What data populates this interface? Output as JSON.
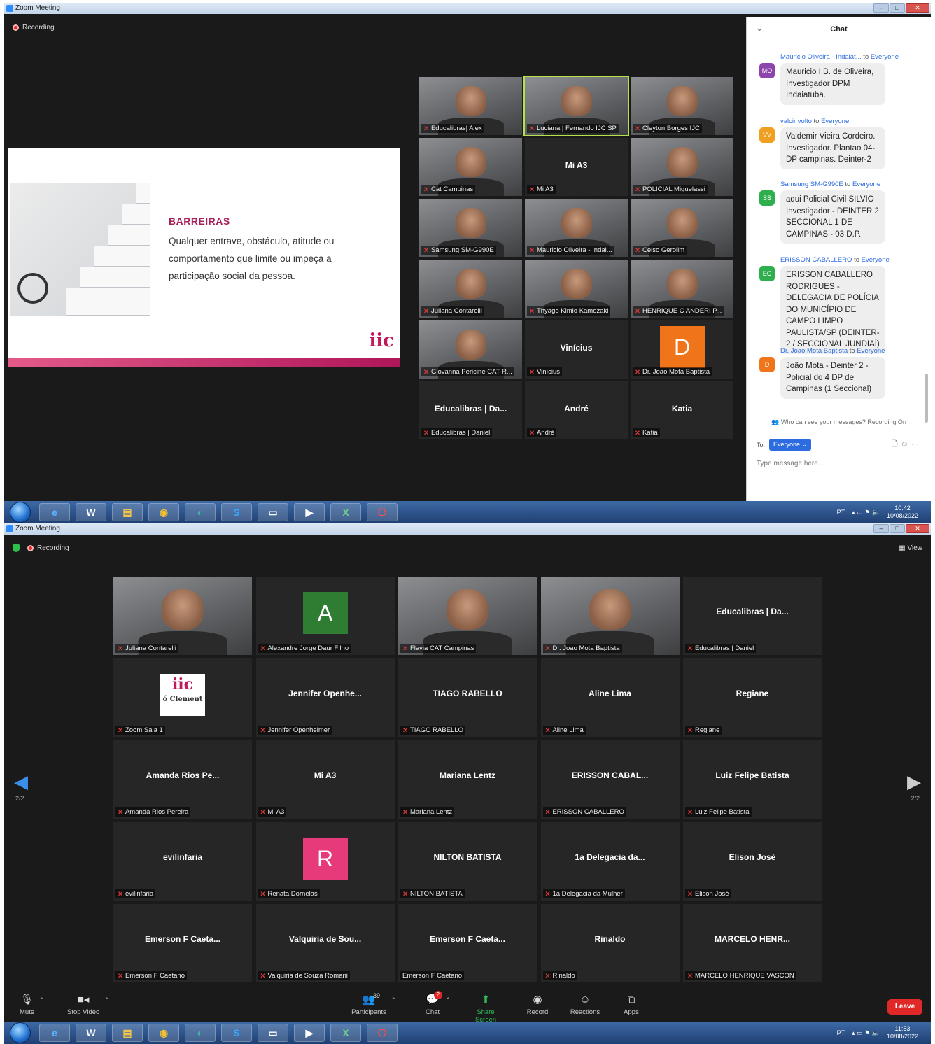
{
  "window_title": "Zoom Meeting",
  "recording_label": "Recording",
  "slide": {
    "title": "BARREIRAS",
    "text": "Qualquer entrave, obstáculo, atitude ou comportamento que limite ou impeça a participação social da pessoa.",
    "logo": "iic"
  },
  "top_tiles": [
    {
      "big": "",
      "name": "Educalibras| Alex",
      "video": true
    },
    {
      "big": "",
      "name": "Luciana | Fernando IJC SP",
      "video": true,
      "active": true
    },
    {
      "big": "",
      "name": "Cleyton Borges IJC",
      "video": true
    },
    {
      "big": "",
      "name": "Cat Campinas",
      "video": true
    },
    {
      "big": "Mi A3",
      "name": "Mi A3",
      "video": false
    },
    {
      "big": "",
      "name": "POLICIAL Miguelassi",
      "video": true
    },
    {
      "big": "",
      "name": "Samsung SM-G990E",
      "video": true
    },
    {
      "big": "",
      "name": "Mauricio Oliveira - Indai...",
      "video": true
    },
    {
      "big": "",
      "name": "Celso Gerolim",
      "video": true
    },
    {
      "big": "",
      "name": "Juliana Contarelli",
      "video": true
    },
    {
      "big": "",
      "name": "Thyago Kimio Kamozaki",
      "video": true
    },
    {
      "big": "",
      "name": "HENRIQUE C ANDERI P...",
      "video": true
    },
    {
      "big": "",
      "name": "Giovanna Pericine CAT R...",
      "video": true
    },
    {
      "big": "Vinícius",
      "name": "Vinícius",
      "video": false
    },
    {
      "big": "",
      "name": "Dr. Joao Mota Baptista",
      "video": false,
      "avatar": "D",
      "avatar_color": "#f0741a"
    },
    {
      "big": "Educalibras | Da...",
      "name": "Educalibras | Daniel",
      "video": false
    },
    {
      "big": "André",
      "name": "André",
      "video": false
    },
    {
      "big": "Katia",
      "name": "Katia",
      "video": false
    }
  ],
  "chat": {
    "title": "Chat",
    "to_word": "to",
    "messages": [
      {
        "from": "Mauricio Oliveira - Indaiat...",
        "to": "Everyone",
        "initials": "MO",
        "color": "#8e44ad",
        "text": "Mauricio I.B. de Oliveira, Investigador DPM Indaiatuba."
      },
      {
        "from": "valcir volto",
        "to": "Everyone",
        "initials": "VV",
        "color": "#f0a020",
        "text": "Valdemir Vieira Cordeiro. Investigador. Plantao 04-DP campinas. Deinter-2"
      },
      {
        "from": "Samsung SM-G990E",
        "to": "Everyone",
        "initials": "SS",
        "color": "#2fae4e",
        "text": "aqui Policial Civil SILVIO Investigador - DEINTER 2 SECCIONAL 1 DE CAMPINAS - 03 D.P."
      },
      {
        "from": "ERISSON CABALLERO",
        "to": "Everyone",
        "initials": "EC",
        "color": "#2fae4e",
        "text": "ERISSON CABALLERO RODRIGUES - DELEGACIA DE POLÍCIA DO MUNICÍPIO DE CAMPO LIMPO PAULISTA/SP (DEINTER-2 / SECCIONAL JUNDIAÍ)"
      },
      {
        "from": "Dr. Joao Mota Baptista",
        "to": "Everyone",
        "initials": "D",
        "color": "#f0741a",
        "text": "João Mota - Deinter 2 - Policial do 4 DP de Campinas (1 Seccional)"
      }
    ],
    "notice": "Who can see your messages? Recording On",
    "to_label": "To:",
    "recipient": "Everyone",
    "placeholder": "Type message here..."
  },
  "taskbar": {
    "lang": "PT",
    "clock1_time": "10:42",
    "clock1_date": "10/08/2022",
    "clock2_time": "11:53",
    "clock2_date": "10/08/2022"
  },
  "gallery": {
    "view_label": "View",
    "page": "2/2",
    "tiles": [
      {
        "big": "",
        "name": "Juliana Contarelli",
        "video": true
      },
      {
        "big": "",
        "name": "Alexandre Jorge Daur Filho",
        "video": false,
        "avatar": "A",
        "avatar_color": "#2e7d32"
      },
      {
        "big": "",
        "name": "Flavia CAT Campinas",
        "video": true
      },
      {
        "big": "",
        "name": "Dr. Joao Mota Baptista",
        "video": true
      },
      {
        "big": "Educalibras | Da...",
        "name": "Educalibras | Daniel",
        "video": false
      },
      {
        "big": "",
        "name": "Zoom Sala 1",
        "video": false,
        "logo": "iic",
        "logo_sub": "ó Clement"
      },
      {
        "big": "Jennifer Openhe...",
        "name": "Jennifer Openheimer",
        "video": false
      },
      {
        "big": "TIAGO RABELLO",
        "name": "TIAGO RABELLO",
        "video": false
      },
      {
        "big": "Aline Lima",
        "name": "Aline Lima",
        "video": false
      },
      {
        "big": "Regiane",
        "name": "Regiane",
        "video": false
      },
      {
        "big": "Amanda Rios Pe...",
        "name": "Amanda Rios Pereira",
        "video": false
      },
      {
        "big": "Mi A3",
        "name": "Mi A3",
        "video": false
      },
      {
        "big": "Mariana Lentz",
        "name": "Mariana Lentz",
        "video": false
      },
      {
        "big": "ERISSON CABAL...",
        "name": "ERISSON CABALLERO",
        "video": false
      },
      {
        "big": "Luiz Felipe Batista",
        "name": "Luiz Felipe Batista",
        "video": false
      },
      {
        "big": "evilinfaria",
        "name": "evilinfaria",
        "video": false
      },
      {
        "big": "",
        "name": "Renata Dornelas",
        "video": false,
        "avatar": "R",
        "avatar_color": "#e63a7a"
      },
      {
        "big": "NILTON BATISTA",
        "name": "NILTON BATISTA",
        "video": false
      },
      {
        "big": "1a Delegacia da...",
        "name": "1a Delegacia da Mulher",
        "video": false
      },
      {
        "big": "Elison José",
        "name": "Elison José",
        "video": false
      },
      {
        "big": "Emerson F Caeta...",
        "name": "Emerson F Caetano",
        "video": false
      },
      {
        "big": "Valquiria de Sou...",
        "name": "Valquiria de Souza Romani",
        "video": false
      },
      {
        "big": "Emerson F Caeta...",
        "name": "Emerson F Caetano",
        "video": false,
        "nomic": true
      },
      {
        "big": "Rinaldo",
        "name": "Rinaldo",
        "video": false
      },
      {
        "big": "MARCELO HENR...",
        "name": "MARCELO HENRIQUE VASCON",
        "video": false
      }
    ]
  },
  "toolbar": {
    "mute": "Mute",
    "stop_video": "Stop Video",
    "participants": "Participants",
    "participants_count": "39",
    "chat": "Chat",
    "chat_badge": "2",
    "share_screen": "Share Screen",
    "record": "Record",
    "reactions": "Reactions",
    "apps": "Apps",
    "leave": "Leave"
  }
}
